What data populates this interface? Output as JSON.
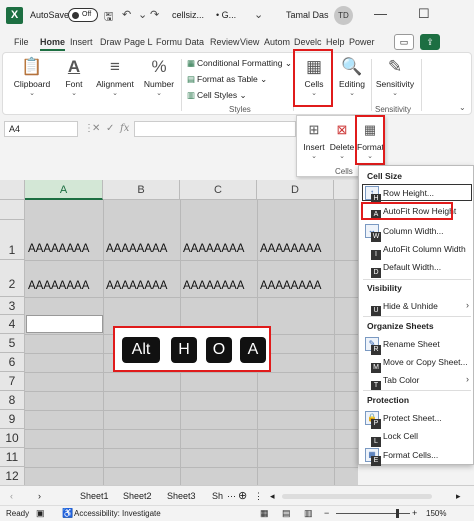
{
  "titlebar": {
    "autosave_label": "AutoSave",
    "autosave_state": "Off",
    "filename": "cellsiz...",
    "general_label": "• G...",
    "user_name": "Tamal Das",
    "user_initials": "TD",
    "minimize": "—",
    "maximize": "☐"
  },
  "tabs": [
    "File",
    "Home",
    "Insert",
    "Draw",
    "Page L",
    "Formu",
    "Data",
    "Review",
    "View",
    "Autom",
    "Develc",
    "Help",
    "Power"
  ],
  "ribbon": {
    "clipboard": "Clipboard",
    "font": "Font",
    "alignment": "Alignment",
    "number": "Number",
    "conditional_formatting": "Conditional Formatting",
    "format_as_table": "Format as Table",
    "cell_styles": "Cell Styles",
    "styles_group": "Styles",
    "cells": "Cells",
    "editing": "Editing",
    "sensitivity": "Sensitivity",
    "sensitivity_group": "Sensitivity"
  },
  "cells_popup": {
    "insert": "Insert",
    "delete": "Delete",
    "format": "Format",
    "group": "Cells"
  },
  "formula_bar": {
    "name_box": "A4",
    "fx": "fx"
  },
  "grid": {
    "columns": [
      "A",
      "B",
      "C",
      "D"
    ],
    "rows": [
      "1",
      "2",
      "3",
      "4",
      "5",
      "6",
      "7",
      "8",
      "9",
      "10",
      "11",
      "12"
    ],
    "row1": [
      "AAAAAAAA",
      "AAAAAAAA",
      "AAAAAAAA",
      "AAAAAAAA"
    ],
    "row2": [
      "AAAAAAAA",
      "AAAAAAAA",
      "AAAAAAAA",
      "AAAAAAAA"
    ]
  },
  "keys": [
    "Alt",
    "H",
    "O",
    "A"
  ],
  "format_menu": {
    "cell_size": "Cell Size",
    "row_height": "Row Height...",
    "autofit_row_height": "AutoFit Row Height",
    "column_width": "Column Width...",
    "autofit_column_width": "AutoFit Column Width",
    "default_width": "Default Width...",
    "visibility": "Visibility",
    "hide_unhide": "Hide & Unhide",
    "organize_sheets": "Organize Sheets",
    "rename_sheet": "Rename Sheet",
    "move_copy_sheet": "Move or Copy Sheet...",
    "tab_color": "Tab Color",
    "protection": "Protection",
    "protect_sheet": "Protect Sheet...",
    "lock_cell": "Lock Cell",
    "format_cells": "Format Cells...",
    "keytips": {
      "row_height": "H",
      "autofit_row_height": "A",
      "column_width": "W",
      "autofit_column_width": "I",
      "default_width": "D",
      "hide_unhide": "U",
      "rename_sheet": "R",
      "move_copy_sheet": "M",
      "tab_color": "T",
      "protect_sheet": "P",
      "lock_cell": "L",
      "format_cells": "E"
    }
  },
  "sheets": [
    "Sheet1",
    "Sheet2",
    "Sheet3",
    "Sh"
  ],
  "status": {
    "ready": "Ready",
    "accessibility": "Accessibility: Investigate",
    "zoom": "150%"
  }
}
